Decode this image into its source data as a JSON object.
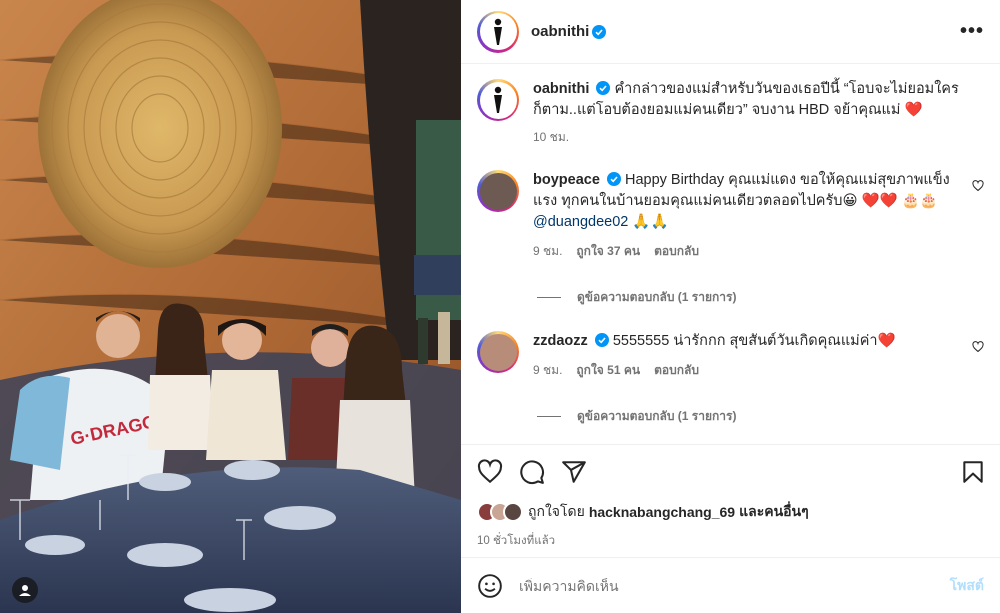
{
  "post": {
    "author": "oabnithi",
    "caption_user": "oabnithi",
    "caption_text": "คำกล่าวของแม่สำหรับวันของเธอปีนี้ “โอบจะไม่ยอมใครก็ตาม..แต่โอบต้องยอมแม่คนเดียว” จบงาน HBD จย้าคุณแม่",
    "caption_emoji": "❤️",
    "caption_time": "10 ชม.",
    "more_label": "•••"
  },
  "comments": [
    {
      "user": "boypeace",
      "text": "Happy Birthday คุณแม่แดง ขอให้คุณแม่สุขภาพแข็งแรง ทุกคนในบ้านยอมคุณแม่คนเดียวตลอดไปครับ😀 ❤️❤️ 🎂🎂",
      "mention": "@duangdee02",
      "after_mention": "🙏🙏",
      "time": "9 ชม.",
      "likes": "ถูกใจ 37 คน",
      "reply": "ตอบกลับ",
      "replies": "ดูข้อความตอบกลับ (1 รายการ)"
    },
    {
      "user": "zzdaozz",
      "text": "5555555 น่ารักกก สุขสันต์วันเกิดคุณแม่ค่า❤️",
      "time": "9 ชม.",
      "likes": "ถูกใจ 51 คน",
      "reply": "ตอบกลับ",
      "replies": "ดูข้อความตอบกลับ (1 รายการ)"
    }
  ],
  "likes_line": {
    "prefix": "ถูกใจโดย",
    "user": "hacknabangchang_69",
    "suffix": "และคนอื่นๆ"
  },
  "post_time": "10 ชั่วโมงที่แล้ว",
  "add_comment": {
    "placeholder": "เพิ่มความคิดเห็น",
    "post_label": "โพสต์"
  },
  "colors": {
    "verified": "#0095f6",
    "like_red": "#ed4956",
    "post_disabled": "#b2dffc"
  },
  "icons": [
    "heart-icon",
    "comment-icon",
    "share-icon",
    "bookmark-icon",
    "emoji-icon",
    "verified-icon",
    "more-icon"
  ]
}
